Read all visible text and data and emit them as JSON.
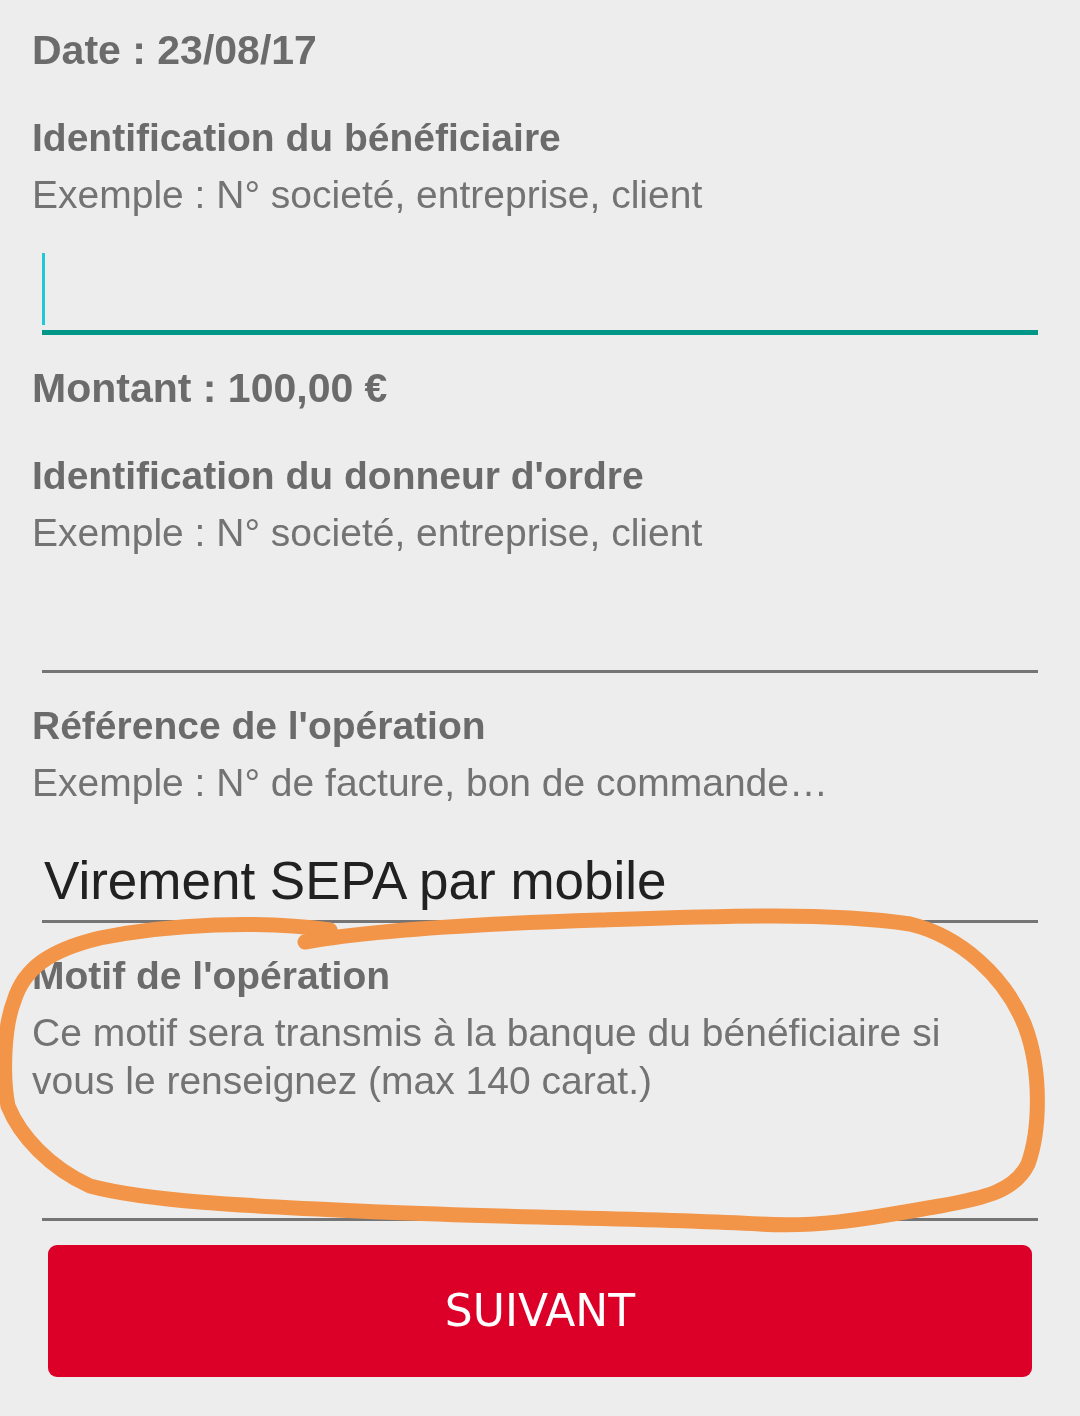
{
  "items": [
    {
      "kind": "info",
      "text": "Date : 23/08/17"
    },
    {
      "kind": "field",
      "label": "Identification du bénéficiaire",
      "hint": "Exemple : N° societé, entreprise, client",
      "focused": true,
      "highlighted": false
    },
    {
      "kind": "info",
      "text": "Montant : 100,00 €"
    },
    {
      "kind": "field",
      "label": "Identification du donneur d'ordre",
      "hint": "Exemple : N° societé, entreprise, client",
      "focused": false,
      "highlighted": false
    },
    {
      "kind": "field",
      "label": "Référence de l'opération",
      "hint": "Exemple : N° de facture, bon de commande…",
      "value": "Virement SEPA par mobile",
      "focused": false,
      "highlighted": false
    },
    {
      "kind": "field",
      "label": "Motif de l'opération",
      "hint": "Ce motif sera transmis à la banque du bénéficiaire si vous le renseignez (max 140 carat.)",
      "focused": false,
      "highlighted": true
    }
  ],
  "button": {
    "label": "SUIVANT"
  }
}
